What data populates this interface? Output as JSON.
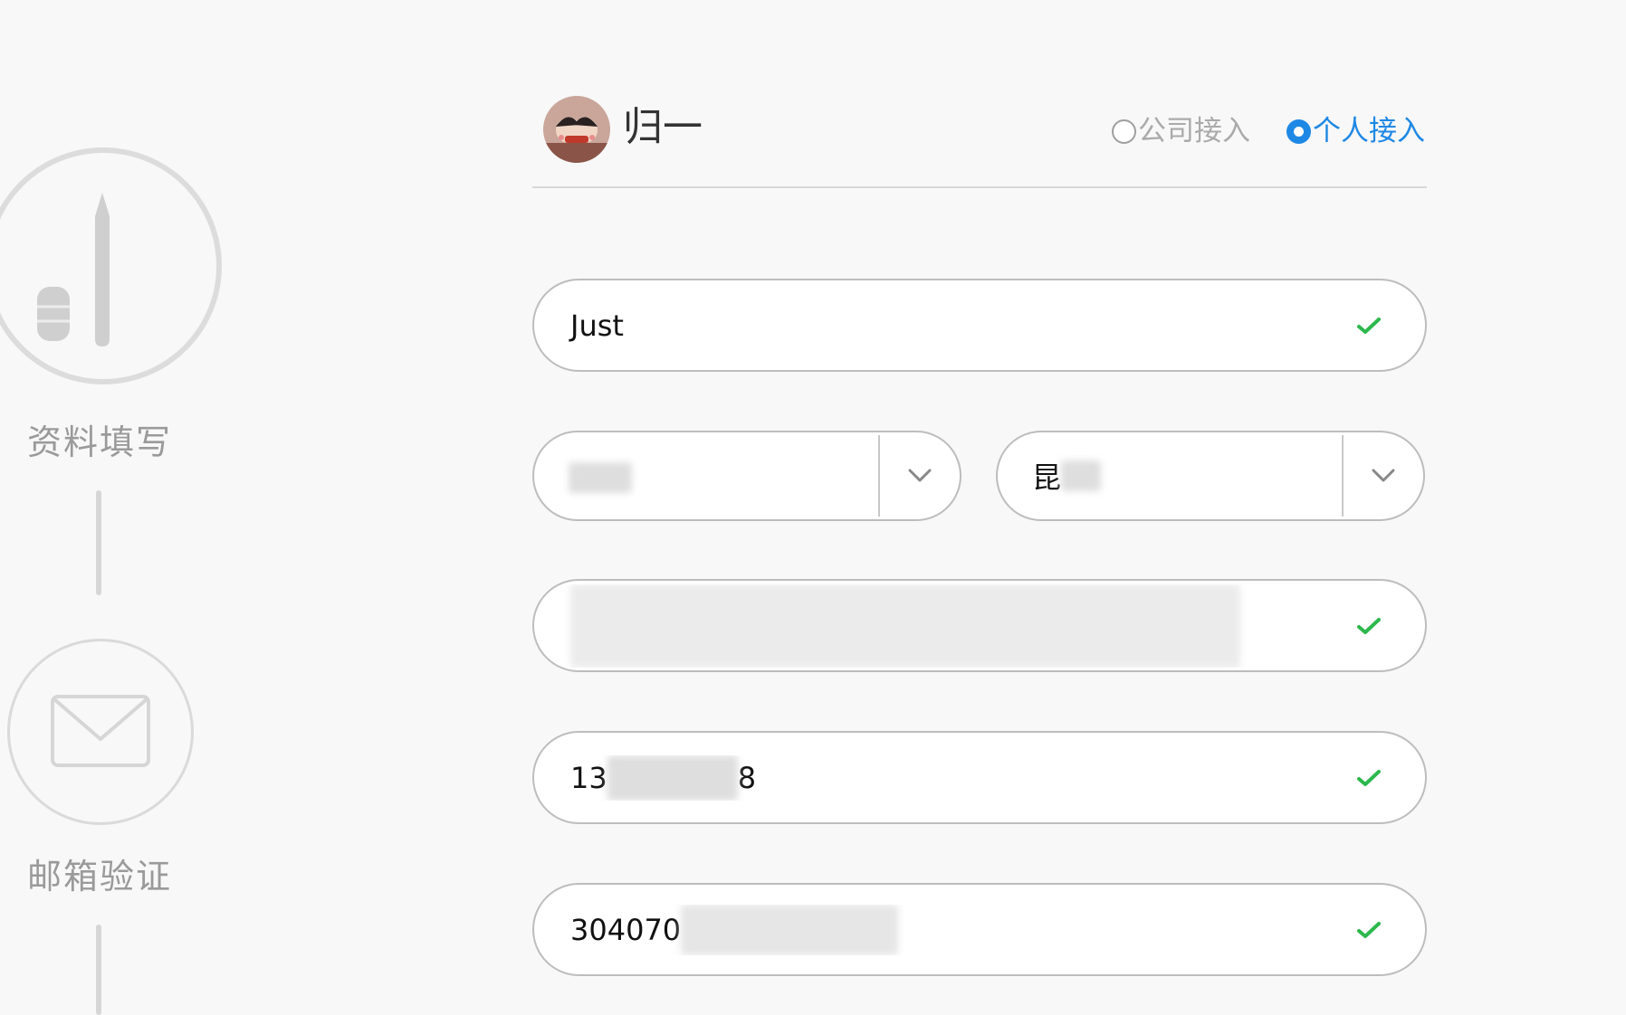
{
  "stepper": {
    "steps": [
      {
        "label": "资料填写",
        "icon": "pen-eraser-icon"
      },
      {
        "label": "邮箱验证",
        "icon": "envelope-icon"
      }
    ]
  },
  "header": {
    "username": "归一",
    "account_type": {
      "options": [
        "公司接入",
        "个人接入"
      ],
      "selected": "个人接入"
    }
  },
  "form": {
    "name": {
      "value": "Just",
      "valid": true
    },
    "province": {
      "value": ""
    },
    "city": {
      "value_visible": "昆"
    },
    "address": {
      "value_visible": "",
      "valid": true
    },
    "phone": {
      "prefix": "13",
      "suffix": "8",
      "valid": true
    },
    "email": {
      "prefix": "304070",
      "valid": true
    }
  },
  "colors": {
    "accent": "#1e88e5",
    "valid_check": "#2db84d",
    "border": "#bdbdbd",
    "step_inactive": "#d6d6d6"
  }
}
